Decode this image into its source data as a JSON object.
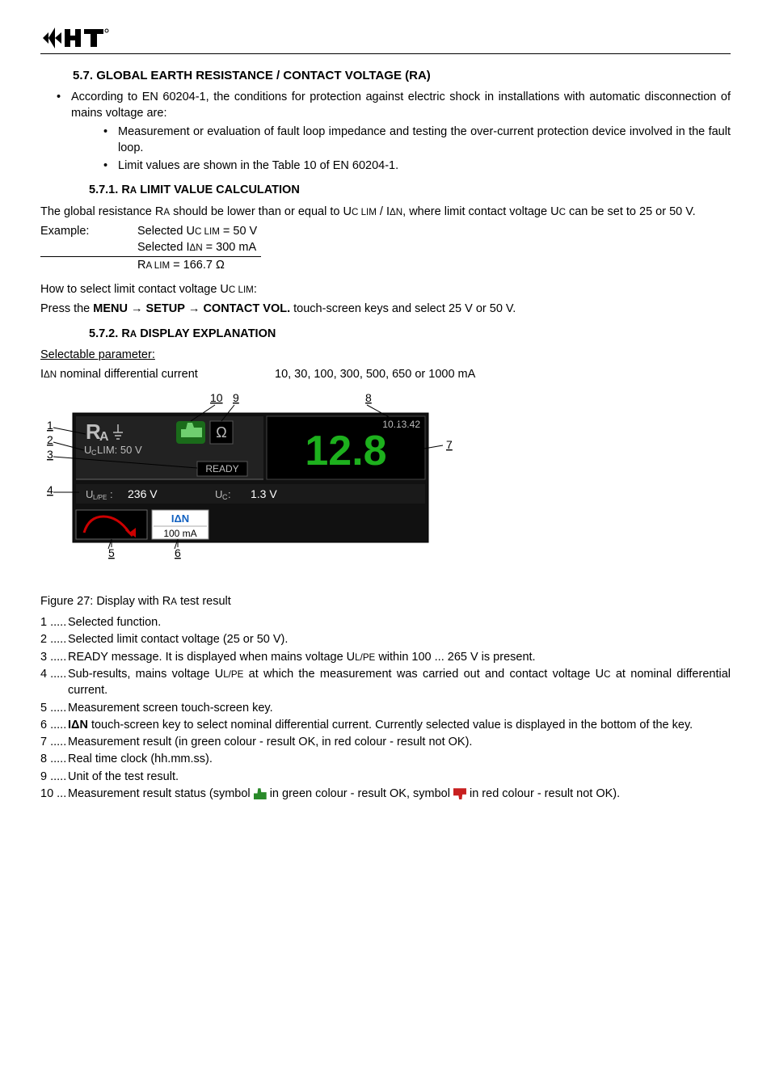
{
  "logo_text": "HT",
  "section": {
    "num": "5.7.",
    "title": "GLOBAL EARTH RESISTANCE / CONTACT VOLTAGE (RA)"
  },
  "intro_bullet": "According to EN 60204-1, the conditions for protection against electric shock in installations with automatic disconnection of mains voltage are:",
  "intro_sub1": "Measurement or evaluation of fault loop impedance and testing the over-current protection device involved in the fault loop.",
  "intro_sub2": "Limit values are shown in the Table 10 of EN 60204-1.",
  "sub571": {
    "num": "5.7.1.",
    "title": "RA LIMIT VALUE CALCULATION"
  },
  "ra_text_a": "The global resistance R",
  "ra_text_b": " should be lower than or equal to U",
  "ra_text_c": " / I",
  "ra_text_d": ", where limit contact voltage U",
  "ra_text_e": " can be set to 25 or 50 V.",
  "example": {
    "label": "Example:",
    "line1a": "Selected U",
    "line1b": " = 50 V",
    "line2a": "Selected I",
    "line2b": "N",
    "line2c": " = 300 mA",
    "line3a": "R",
    "line3b": " = 166.7 "
  },
  "howto": {
    "a": "How to select limit contact voltage U",
    "b": ":"
  },
  "press_a": "Press the ",
  "press_menu": "MENU",
  "press_setup": "SETUP",
  "press_contact": "CONTACT VOL.",
  "press_tail": " touch-screen keys and select 25 V or 50 V.",
  "sub572": {
    "num": "5.7.2.",
    "title": "RA DISPLAY EXPLANATION"
  },
  "selectable_label": "Selectable parameter:",
  "param_label_a": "I",
  "param_label_b": "N",
  "param_label_c": " nominal differential current",
  "param_values": "10, 30, 100, 300, 500, 650 or 1000 mA",
  "screen": {
    "ra_title": "R",
    "ra_a": "A",
    "uc_lim": "UC LIM: 50 V",
    "ready": "READY",
    "ulpe_label": "UL/PE:",
    "ulpe_val": "236 V",
    "uc_label": "UC:",
    "uc_val": "1.3 V",
    "ian": "IΔN",
    "ian_val": "100 mA",
    "ohm": "Ω",
    "clock": "10.13.42",
    "result": "12.8",
    "pointers": {
      "p1": "1",
      "p2": "2",
      "p3": "3",
      "p4": "4",
      "p5": "5",
      "p6": "6",
      "p7": "7",
      "p8": "8",
      "p9": "9",
      "p10": "10"
    }
  },
  "figure_caption_a": "Figure 27",
  "figure_caption_b": ": Display with R",
  "figure_caption_c": " test result",
  "items": {
    "n1": "1 .....",
    "t1": "Selected function.",
    "n2": "2 .....",
    "t2": "Selected limit contact voltage (25 or 50 V).",
    "n3": "3 .....",
    "t3a": "READY message. It is displayed when mains voltage U",
    "t3b": " within 100 ... 265 V is present.",
    "n4": "4 .....",
    "t4a": "Sub-results, mains voltage U",
    "t4b": " at which the measurement was carried out and contact voltage U",
    "t4c": " at nominal differential current.",
    "n5": "5 .....",
    "t5": "Measurement screen touch-screen key.",
    "n6": "6 .....",
    "t6a": "I",
    "t6b": "N",
    "t6c": " touch-screen key to select nominal differential current. Currently selected value is displayed in the bottom of the key.",
    "n7": "7 .....",
    "t7": "Measurement result (in green colour - result OK, in red colour - result not OK).",
    "n8": "8 .....",
    "t8": "Real time clock (hh.mm.ss).",
    "n9": "9 .....",
    "t9": "Unit of the test result.",
    "n10": "10 ...",
    "t10a": "Measurement result status (symbol ",
    "t10b": " in green colour - result OK, symbol ",
    "t10c": " in red colour - result not OK)."
  },
  "small": {
    "A": "A",
    "C": "C",
    "C_LIM": "C LIM",
    "DN": "ΔN",
    "A_LIM": "A LIM",
    "L_PE": "L/PE"
  }
}
